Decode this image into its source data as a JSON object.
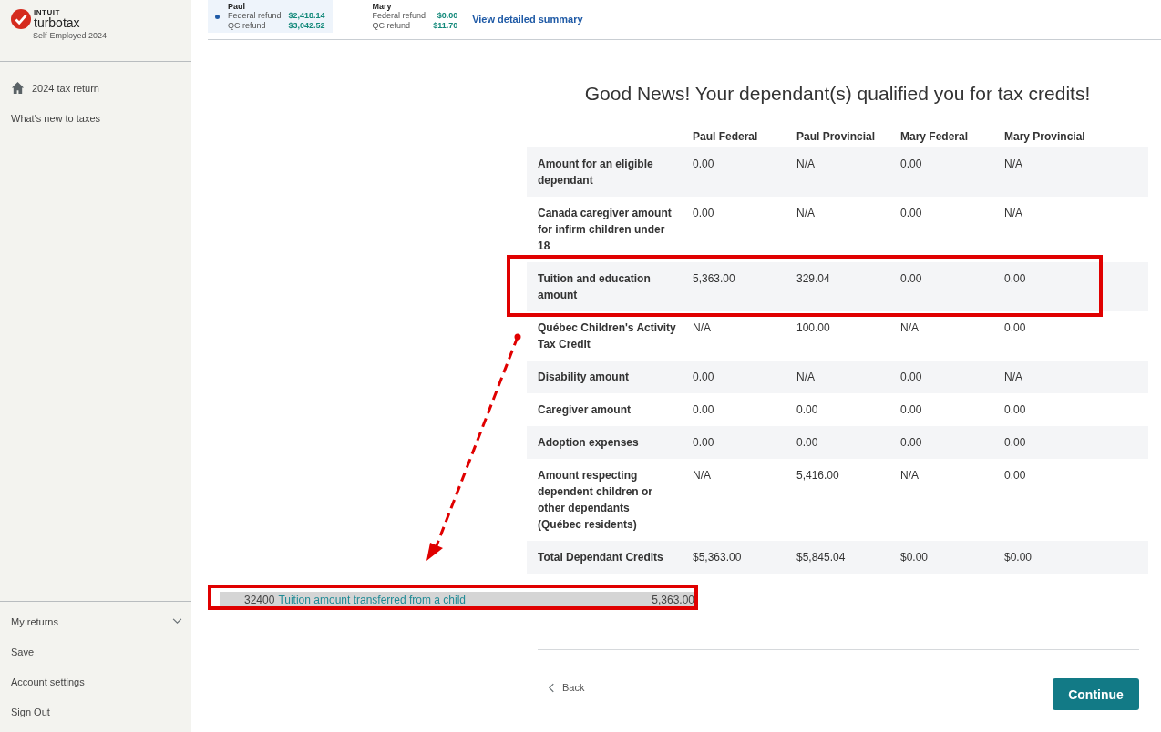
{
  "sidebar": {
    "brand": {
      "company": "INTUIT",
      "product": "turbotax",
      "edition": "Self-Employed 2024"
    },
    "nav": [
      {
        "label": "2024 tax return",
        "kind": "home"
      },
      {
        "label": "What's new to taxes",
        "kind": "plain"
      }
    ],
    "bottom_nav": [
      {
        "label": "My returns",
        "kind": "menu",
        "expanded": false
      },
      {
        "label": "Save",
        "kind": "plain"
      },
      {
        "label": "Account settings",
        "kind": "plain"
      },
      {
        "label": "Sign Out",
        "kind": "plain"
      }
    ]
  },
  "refund_summary": {
    "people": [
      {
        "name": "Paul",
        "selected": true,
        "lines": [
          {
            "label": "Federal refund",
            "amount": "$2,418.14"
          },
          {
            "label": "QC refund",
            "amount": "$3,042.52"
          }
        ]
      },
      {
        "name": "Mary",
        "selected": false,
        "lines": [
          {
            "label": "Federal refund",
            "amount": "$0.00"
          },
          {
            "label": "QC refund",
            "amount": "$11.70"
          }
        ]
      }
    ],
    "link": "View detailed summary"
  },
  "heading": "Good News! Your dependant(s) qualified you for tax credits!",
  "table": {
    "columns": [
      "Paul Federal",
      "Paul Provincial",
      "Mary Federal",
      "Mary Provincial"
    ],
    "rows": [
      {
        "label": "Amount for an eligible dependant",
        "values": [
          "0.00",
          "N/A",
          "0.00",
          "N/A"
        ],
        "highlighted": false
      },
      {
        "label": "Canada caregiver amount for infirm children under 18",
        "values": [
          "0.00",
          "N/A",
          "0.00",
          "N/A"
        ],
        "highlighted": false
      },
      {
        "label": "Tuition and education amount",
        "values": [
          "5,363.00",
          "329.04",
          "0.00",
          "0.00"
        ],
        "highlighted": true
      },
      {
        "label": "Québec Children's Activity Tax Credit",
        "values": [
          "N/A",
          "100.00",
          "N/A",
          "0.00"
        ],
        "highlighted": false
      },
      {
        "label": "Disability amount",
        "values": [
          "0.00",
          "N/A",
          "0.00",
          "N/A"
        ],
        "highlighted": false
      },
      {
        "label": "Caregiver amount",
        "values": [
          "0.00",
          "0.00",
          "0.00",
          "0.00"
        ],
        "highlighted": false
      },
      {
        "label": "Adoption expenses",
        "values": [
          "0.00",
          "0.00",
          "0.00",
          "0.00"
        ],
        "highlighted": false
      },
      {
        "label": "Amount respecting dependent children or other dependants (Québec residents)",
        "values": [
          "N/A",
          "5,416.00",
          "N/A",
          "0.00"
        ],
        "highlighted": false
      },
      {
        "label": "Total Dependant Credits",
        "values": [
          "$5,363.00",
          "$5,845.04",
          "$0.00",
          "$0.00"
        ],
        "highlighted": false
      }
    ]
  },
  "excerpt": {
    "code": "32400",
    "label": "Tuition amount transferred from a child",
    "amount": "5,363.00",
    "highlighted": true
  },
  "footer": {
    "back": "Back",
    "continue": "Continue"
  }
}
